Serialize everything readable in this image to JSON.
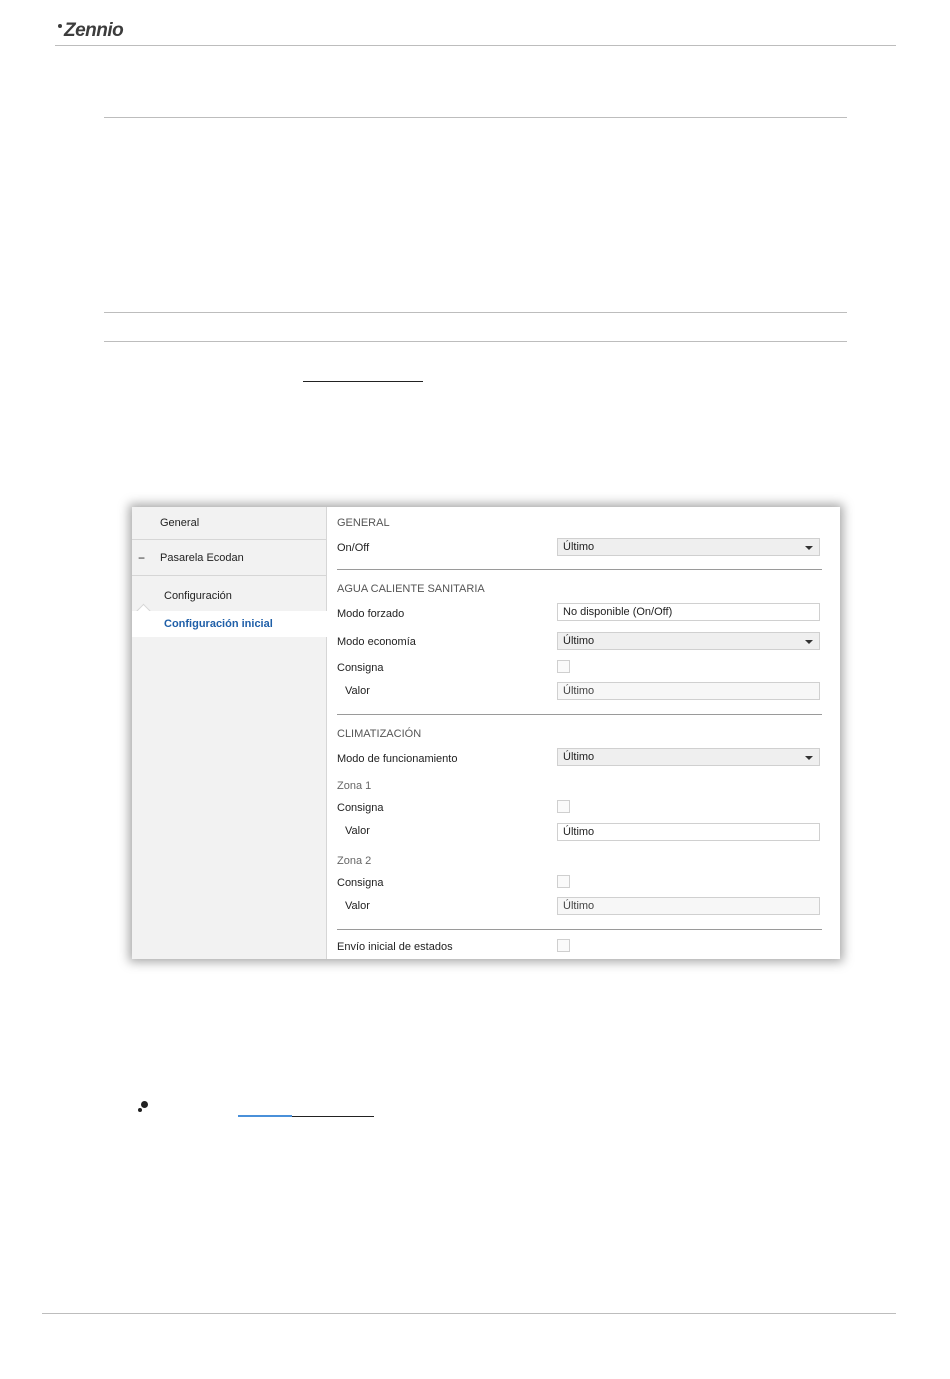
{
  "header": {
    "logo_text": "Zennio"
  },
  "screenshot": {
    "sidebar": {
      "general": "General",
      "collapse_symbol": "−",
      "pasarela": "Pasarela Ecodan",
      "configuracion": "Configuración",
      "configuracion_inicial": "Configuración inicial"
    },
    "general_section": {
      "title": "GENERAL",
      "onoff_label": "On/Off",
      "onoff_value": "Último"
    },
    "acs_section": {
      "title": "AGUA CALIENTE SANITARIA",
      "modo_forzado_label": "Modo forzado",
      "modo_forzado_value": "No disponible (On/Off)",
      "modo_economia_label": "Modo economía",
      "modo_economia_value": "Último",
      "consigna_label": "Consigna",
      "valor_label": "Valor",
      "valor_value": "Último"
    },
    "clima_section": {
      "title": "CLIMATIZACIÓN",
      "modo_funcionamiento_label": "Modo de funcionamiento",
      "modo_funcionamiento_value": "Último",
      "zona1_label": "Zona 1",
      "zona1_consigna_label": "Consigna",
      "zona1_valor_label": "Valor",
      "zona1_valor_value": "Último",
      "zona2_label": "Zona 2",
      "zona2_consigna_label": "Consigna",
      "zona2_valor_label": "Valor",
      "zona2_valor_value": "Último"
    },
    "envio_label": "Envío inicial de estados"
  }
}
